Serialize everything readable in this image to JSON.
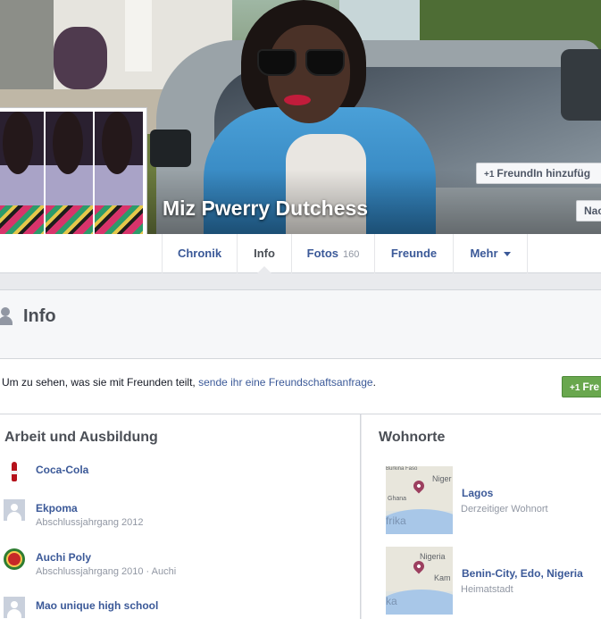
{
  "profile": {
    "name": "Miz Pwerry Dutchess",
    "add_friend_label": "FreundIn hinzufüg",
    "message_label": "Nac",
    "plus_glyph": "+1"
  },
  "tabs": [
    {
      "label": "Chronik",
      "count": ""
    },
    {
      "label": "Info",
      "count": ""
    },
    {
      "label": "Fotos",
      "count": "160"
    },
    {
      "label": "Freunde",
      "count": ""
    },
    {
      "label": "Mehr",
      "count": ""
    }
  ],
  "info_section": {
    "title": "Info",
    "notice_text": "Um zu sehen, was sie mit Freunden teilt, ",
    "notice_link": "sende ihr eine Freundschaftsanfrage",
    "notice_end": ".",
    "small_add_label": "Fre"
  },
  "work_education": {
    "title": "Arbeit und Ausbildung",
    "items": [
      {
        "name": "Coca-Cola",
        "sub": "",
        "icon": "coca-cola-icon"
      },
      {
        "name": "Ekpoma",
        "sub": "Abschlussjahrgang 2012",
        "icon": "default-page-icon"
      },
      {
        "name": "Auchi Poly",
        "sub": "Abschlussjahrgang 2010 · Auchi",
        "icon": "school-crest-icon"
      },
      {
        "name": "Mao unique high school",
        "sub": "",
        "icon": "default-page-icon"
      }
    ]
  },
  "places": {
    "title": "Wohnorte",
    "items": [
      {
        "name": "Lagos",
        "sub": "Derzeitiger Wohnort",
        "map_labels": [
          "Burkina Faso",
          "Niger",
          "Ghana",
          "frika"
        ]
      },
      {
        "name": "Benin-City, Edo, Nigeria",
        "sub": "Heimatstadt",
        "map_labels": [
          "Nigeria",
          "Kam",
          "ka"
        ]
      }
    ]
  },
  "colors": {
    "link": "#3b5998",
    "button_green": "#69a74e",
    "muted": "#9197a3",
    "page_bg": "#e9eaed"
  }
}
